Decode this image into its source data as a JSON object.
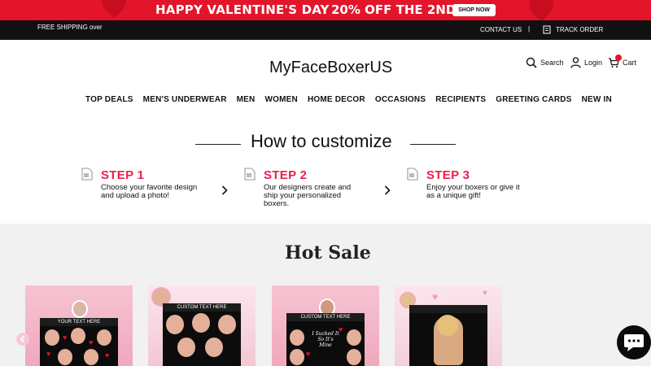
{
  "promo": {
    "headline": "HAPPY VALENTINE'S DAY",
    "offer": "20% OFF THE 2ND",
    "button": "SHOP NOW",
    "color": "#e3152b"
  },
  "topbar": {
    "shipping": "FREE SHIPPING over",
    "contact": "CONTACT US",
    "separator": "|",
    "track": "TRACK ORDER"
  },
  "header": {
    "brand": "MyFaceBoxerUS",
    "search": "Search",
    "login": "Login",
    "cart": "Cart"
  },
  "nav": [
    "TOP DEALS",
    "MEN'S UNDERWEAR",
    "MEN",
    "WOMEN",
    "HOME DECOR",
    "OCCASIONS",
    "RECIPIENTS",
    "GREETING CARDS",
    "NEW IN"
  ],
  "how": {
    "title": "How to customize",
    "steps": [
      {
        "title": "STEP 1",
        "desc": "Choose your favorite design and upload a photo!"
      },
      {
        "title": "STEP 2",
        "desc": "Our designers create and ship your personalized boxers."
      },
      {
        "title": "STEP 3",
        "desc": "Enjoy your boxers or give it as a unique gift!"
      }
    ]
  },
  "hot_sale": {
    "title": "Hot Sale",
    "products": [
      {
        "band_text": "YOUR TEXT HERE"
      },
      {
        "band_text": "CUSTOM TEXT HERE"
      },
      {
        "band_text": "CUSTOM TEXT HERE",
        "tag": "I Sucked It So It's Mine"
      },
      {
        "band_text": ""
      }
    ]
  },
  "colors": {
    "accent": "#e8204c",
    "dark": "#111111",
    "section_bg": "#f1f1f1"
  },
  "icons": [
    "search-icon",
    "user-icon",
    "cart-icon",
    "track-icon",
    "document-icon",
    "chevron-right-icon",
    "chat-icon"
  ]
}
